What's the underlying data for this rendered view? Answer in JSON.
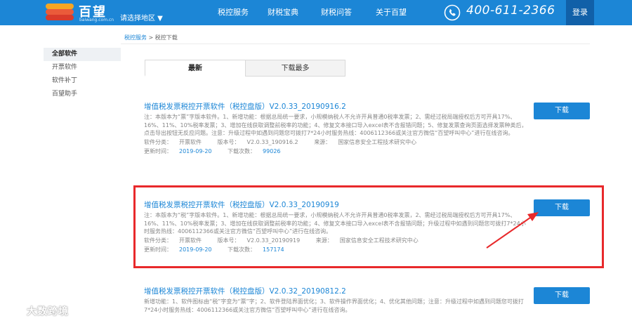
{
  "header": {
    "logo_text": "百望",
    "logo_sub": "baiwang.com.cn",
    "region": "请选择地区 ▼",
    "nav": [
      "税控服务",
      "财税宝典",
      "财税问答",
      "关于百望"
    ],
    "phone": "400-611-2366",
    "login": "登录"
  },
  "breadcrumb": {
    "link": "税控服务",
    "separator": ">",
    "current": "税控下载"
  },
  "sidebar": {
    "items": [
      "全部软件",
      "开票软件",
      "软件补丁",
      "百望助手"
    ],
    "active_index": 0
  },
  "tabs": [
    "最新",
    "下载最多"
  ],
  "labels": {
    "category": "软件分类：",
    "version": "版本号：",
    "source": "来源：",
    "updated": "更新时间：",
    "downloads": "下载次数："
  },
  "entries": [
    {
      "title": "增值税发票税控开票软件（税控盘版）V2.0.33_20190916.2",
      "description": "注：本版本为“票”字版本软件。1、新增功能：根据总局统一要求，小规模纳税人不允许开具普通0税率发票；2、需经过税局端授权后方可开具17%、16%、11%、10%税率发票；3、增加在线获取调整前税率的功能；4、修复文本接口导入excel表不含报错问题；5、修复发票查询页面选择发票种类后，点击导出按钮无反应问题。注意：升级过程中如遇到问题您可拨打7*24小时服务热线：4006112366或关注官方微信“百望呼叫中心”进行在线咨询。",
      "category": "开票软件",
      "version": "V2.0.33_190916.2",
      "source": "国家信息安全工程技术研究中心",
      "updated": "2019-09-20",
      "downloads": "99026",
      "button": "下载"
    },
    {
      "title": "增值税发票税控开票软件（税控盘版）V2.0.33_20190919",
      "description": "注：本版本为“税”字版本软件。1、新增功能：根据总局统一要求，小规模纳税人不允许开具普通0税率发票，2、需经过税局端授权后方可开具17%、16%、11%、10%税率发票；3、增加在线获取调整前税率的功能；4、修复文本接口导入excel表不含报错问题；升级过程中如遇到问题您可拨打7*24小时服务热线：4006112366或关注官方微信“百望呼叫中心”进行在线咨询。",
      "category": "开票软件",
      "version": "V2.0.33_20190919",
      "source": "国家信息安全工程技术研究中心",
      "updated": "2019-09-20",
      "downloads": "157174",
      "button": "下载"
    },
    {
      "title": "增值税发票税控开票软件（税控盘版）V2.0.32_20190812.2",
      "description": "新增功能：1、软件图标由“税”字变为“票”字；2、软件登陆界面优化；3、软件操作界面优化；4、优化其他问题；注意：升级过程中如遇到问题您可拨打7*24小时服务热线：4006112366或关注官方微信“百望呼叫中心”进行在线咨询。",
      "button": "下载"
    }
  ],
  "watermark": "大数跨境",
  "colors": {
    "brand": "#1c86d6",
    "login_bg": "#1160a8",
    "highlight": "#e8292b"
  }
}
